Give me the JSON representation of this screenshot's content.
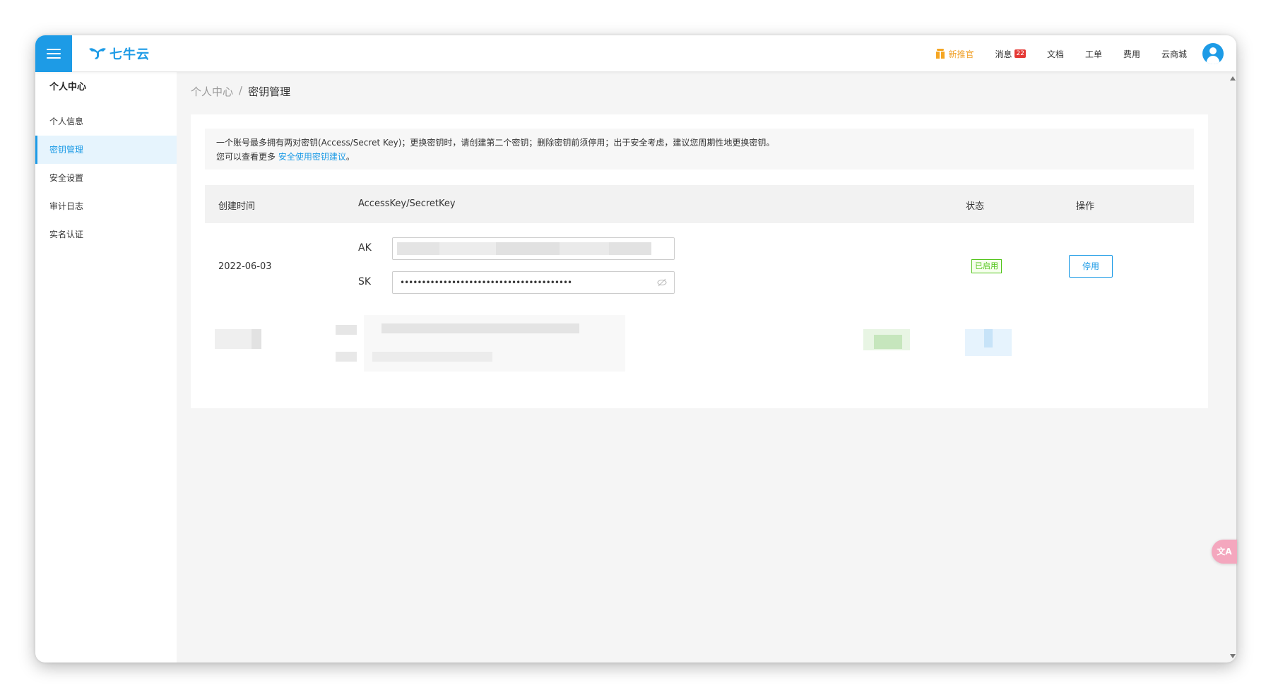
{
  "brand": {
    "name": "七牛云",
    "color": "#1d9be6"
  },
  "topbar": {
    "promo_label": "新推官",
    "messages_label": "消息",
    "messages_count": "22",
    "docs_label": "文档",
    "tickets_label": "工单",
    "billing_label": "费用",
    "market_label": "云商城"
  },
  "sidebar": {
    "title": "个人中心",
    "items": [
      {
        "label": "个人信息"
      },
      {
        "label": "密钥管理"
      },
      {
        "label": "安全设置"
      },
      {
        "label": "审计日志"
      },
      {
        "label": "实名认证"
      }
    ]
  },
  "breadcrumb": {
    "parent": "个人中心",
    "separator": "/",
    "current": "密钥管理"
  },
  "notice": {
    "line1": "一个账号最多拥有两对密钥(Access/Secret Key)；更换密钥时，请创建第二个密钥；删除密钥前须停用；出于安全考虑，建议您周期性地更换密钥。",
    "line2_prefix": "您可以查看更多",
    "link": "安全使用密钥建议",
    "line2_suffix": "。"
  },
  "table": {
    "headers": {
      "created": "创建时间",
      "keys": "AccessKey/SecretKey",
      "status": "状态",
      "actions": "操作"
    },
    "rows": [
      {
        "created": "2022-06-03",
        "ak_label": "AK",
        "sk_label": "SK",
        "sk_value": "••••••••••••••••••••••••••••••••••••••••",
        "status": "已启用",
        "action": "停用"
      }
    ]
  },
  "translate_button": "文A",
  "colors": {
    "accent": "#1d9be6",
    "status_ok": "#52c41a",
    "promo": "#f0a12b",
    "badge": "#e53935"
  }
}
